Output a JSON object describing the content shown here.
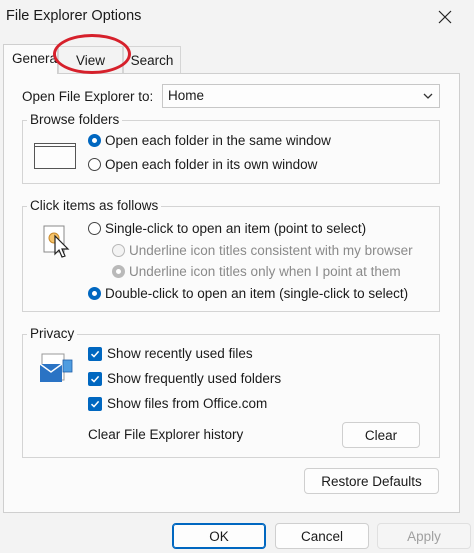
{
  "window": {
    "title": "File Explorer Options"
  },
  "tabs": [
    {
      "label": "General"
    },
    {
      "label": "View"
    },
    {
      "label": "Search"
    }
  ],
  "general": {
    "open_to_label": "Open File Explorer to:",
    "open_to_value": "Home",
    "browse_folders": {
      "legend": "Browse folders",
      "options": [
        {
          "label": "Open each folder in the same window",
          "checked": true
        },
        {
          "label": "Open each folder in its own window",
          "checked": false
        }
      ]
    },
    "click_items": {
      "legend": "Click items as follows",
      "single_click": "Single-click to open an item (point to select)",
      "underline_always": "Underline icon titles consistent with my browser",
      "underline_point": "Underline icon titles only when I point at them",
      "double_click": "Double-click to open an item (single-click to select)"
    },
    "privacy": {
      "legend": "Privacy",
      "options": [
        {
          "label": "Show recently used files",
          "checked": true
        },
        {
          "label": "Show frequently used folders",
          "checked": true
        },
        {
          "label": "Show files from Office.com",
          "checked": true
        }
      ],
      "clear_history_label": "Clear File Explorer history",
      "clear_button": "Clear"
    },
    "restore_defaults": "Restore Defaults"
  },
  "footer": {
    "ok": "OK",
    "cancel": "Cancel",
    "apply": "Apply"
  },
  "colors": {
    "accent": "#0067c0",
    "annotation": "#d6202b"
  },
  "icons": [
    "close-icon",
    "chevron-down-icon",
    "folder-window-icon",
    "pointer-click-icon",
    "privacy-shield-icon",
    "checkmark-icon"
  ]
}
